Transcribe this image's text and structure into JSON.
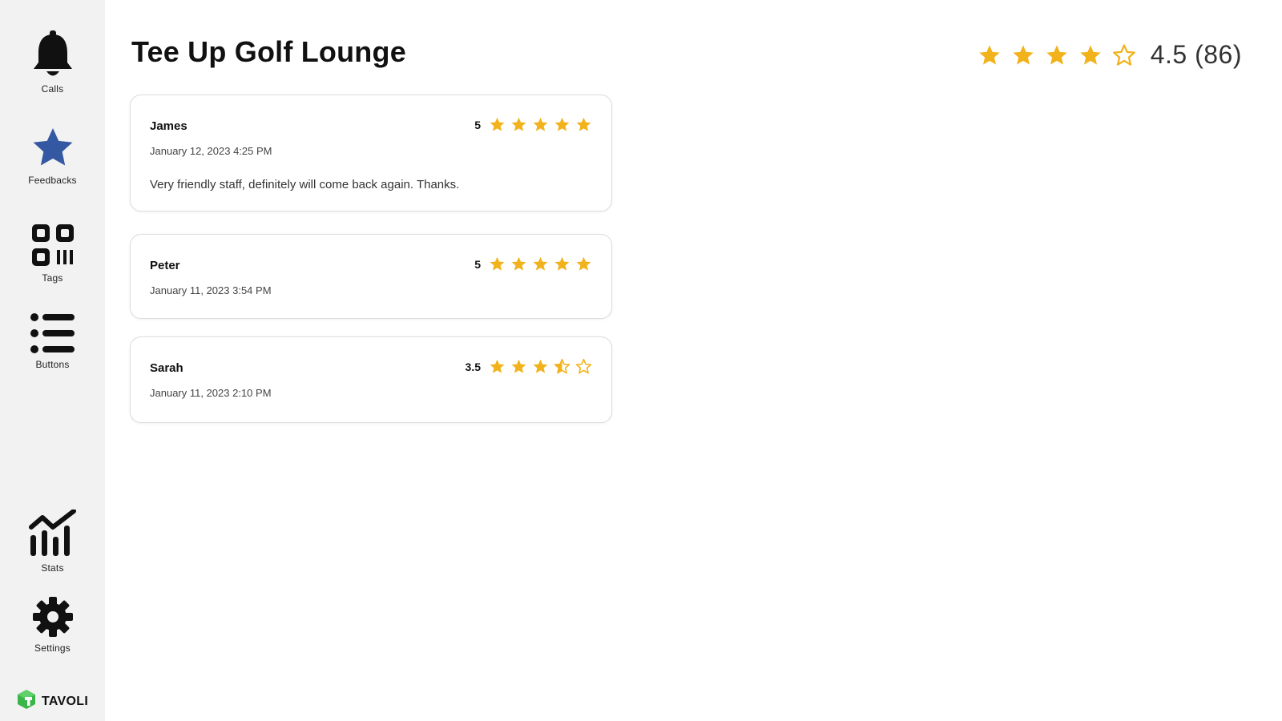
{
  "colors": {
    "star": "#f2b21b",
    "feedback_icon": "#3558a3",
    "brand_green": "#3ab54a"
  },
  "sidebar": {
    "items": [
      {
        "label": "Calls",
        "icon": "bell-icon"
      },
      {
        "label": "Feedbacks",
        "icon": "star-icon",
        "active": true
      },
      {
        "label": "Tags",
        "icon": "tags-grid-icon"
      },
      {
        "label": "Buttons",
        "icon": "list-icon"
      },
      {
        "label": "Stats",
        "icon": "stats-chart-icon"
      },
      {
        "label": "Settings",
        "icon": "gear-icon"
      }
    ],
    "brand": {
      "name": "TAVOLI",
      "icon": "tavoli-logo-icon"
    }
  },
  "header": {
    "title": "Tee Up Golf Lounge",
    "rating": {
      "stars_filled": 4,
      "stars_total": 5,
      "value_text": "4.5 (86)"
    }
  },
  "reviews": [
    {
      "name": "James",
      "date": "January 12, 2023 4:25 PM",
      "score": "5",
      "stars": [
        "full",
        "full",
        "full",
        "full",
        "full"
      ],
      "comment": "Very friendly staff, definitely will come back again. Thanks."
    },
    {
      "name": "Peter",
      "date": "January 11, 2023 3:54 PM",
      "score": "5",
      "stars": [
        "full",
        "full",
        "full",
        "full",
        "full"
      ],
      "comment": ""
    },
    {
      "name": "Sarah",
      "date": "January 11, 2023 2:10 PM",
      "score": "3.5",
      "stars": [
        "full",
        "full",
        "full",
        "half",
        "empty"
      ],
      "comment": ""
    }
  ]
}
